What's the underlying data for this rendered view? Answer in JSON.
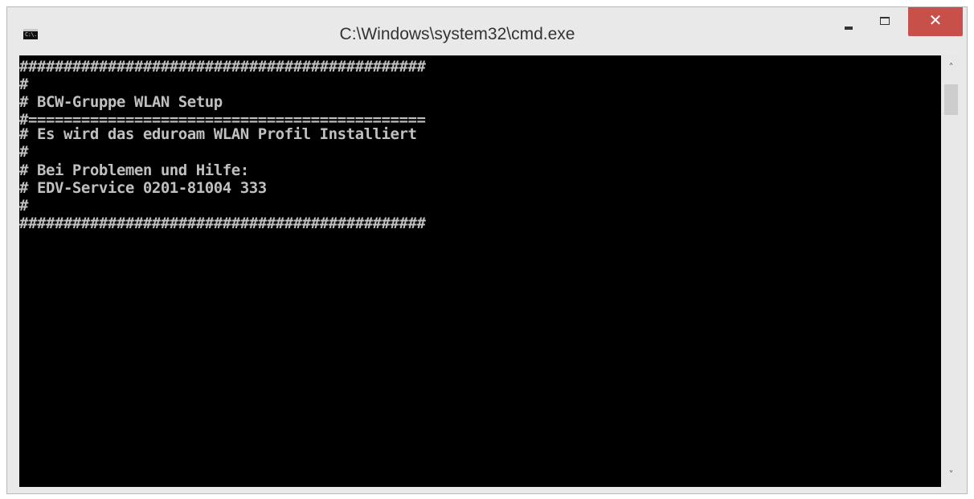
{
  "window": {
    "title": "C:\\Windows\\system32\\cmd.exe",
    "icon_label": "C:\\.",
    "close_glyph": "✕"
  },
  "console": {
    "lines": [
      "##############################################",
      "#",
      "# BCW-Gruppe WLAN Setup",
      "#=============================================",
      "# Es wird das eduroam WLAN Profil Installiert",
      "#",
      "# Bei Problemen und Hilfe:",
      "# EDV-Service 0201-81004 333",
      "#",
      "##############################################"
    ]
  },
  "scrollbar": {
    "up_arrow": "˄",
    "down_arrow": "˅"
  },
  "colors": {
    "console_bg": "#000000",
    "console_text": "#c0c0c0",
    "close_button": "#c7504a",
    "titlebar": "#e9e9e9"
  }
}
